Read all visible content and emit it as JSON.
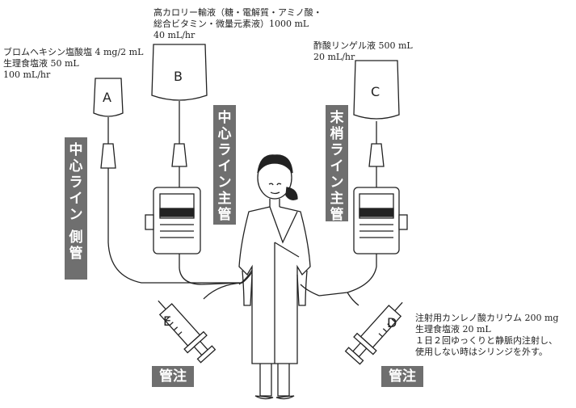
{
  "labels": {
    "top": [
      "高カロリー輸液（糖・電解質・アミノ酸・",
      "総合ビタミン・微量元素液）1000 mL",
      "40 mL/hr"
    ],
    "left": [
      "ブロムヘキシン塩酸塩 4 mg/2 mL",
      "生理食塩液 50 mL",
      "100 mL/hr"
    ],
    "right": [
      "酢酸リンゲル液 500 mL",
      "20 mL/hr"
    ],
    "bottom_right": [
      "注射用カンレノ酸カリウム 200 mg",
      "生理食塩液 20 mL",
      "１日２回ゆっくりと静脈内注射し、",
      "使用しない時はシリンジを外す。"
    ]
  },
  "tags": {
    "central_side": [
      "中",
      "心",
      "ラ",
      "イ",
      "ン",
      "",
      "側",
      "管"
    ],
    "central_main": [
      "中",
      "心",
      "ラ",
      "イ",
      "ン",
      "",
      "主",
      "管"
    ],
    "peripheral_main": [
      "末",
      "梢",
      "ラ",
      "イ",
      "ン",
      "",
      "主",
      "管"
    ],
    "bolus_left": "管注",
    "bolus_right": "管注"
  },
  "letters": {
    "a": "A",
    "b": "B",
    "c": "C",
    "d": "D",
    "e": "E"
  },
  "colors": {
    "tag_bg": "#6f6f6f",
    "line": "#222222"
  }
}
